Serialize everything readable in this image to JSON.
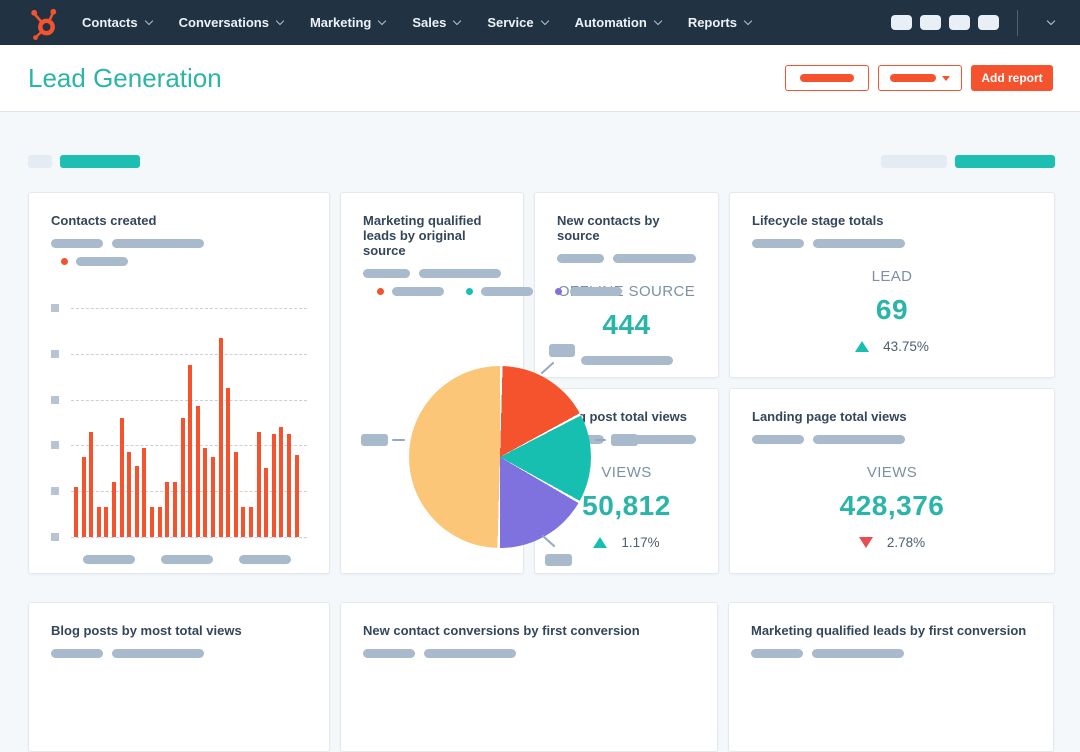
{
  "colors": {
    "navy_bar": "#213343",
    "orange": "#f4532d",
    "teal": "#1dbfb2",
    "teal_text": "#2ab5a8",
    "purple": "#7f72de",
    "yellow": "#fbc678",
    "pie_teal": "#17bfb0",
    "red_down": "#e94c53",
    "title_text": "#33475b",
    "muted_label": "#7d90a5",
    "skeleton_dark": "#a8bacb",
    "skeleton_light": "#e4ebf2",
    "page_bg": "#f5f8fb",
    "card_border": "#e4e9f0",
    "grid_line": "#c6d1dc"
  },
  "nav": {
    "items": [
      {
        "label": "Contacts"
      },
      {
        "label": "Conversations"
      },
      {
        "label": "Marketing"
      },
      {
        "label": "Sales"
      },
      {
        "label": "Service"
      },
      {
        "label": "Automation"
      },
      {
        "label": "Reports"
      }
    ],
    "icon_placeholder_count": 4
  },
  "header": {
    "title": "Lead Generation",
    "add_report_label": "Add report"
  },
  "cards": {
    "contacts_created": {
      "title": "Contacts created"
    },
    "new_contacts_by_source": {
      "title": "New contacts by source",
      "metric_label": "OFFLINE SOURCE",
      "value": "444"
    },
    "lifecycle_stage_totals": {
      "title": "Lifecycle stage totals",
      "metric_label": "LEAD",
      "value": "69",
      "delta": "43.75%",
      "direction": "up"
    },
    "mql_by_original_source": {
      "title": "Marketing qualified leads by original source"
    },
    "blog_post_total_views": {
      "title": "Blog post total views",
      "metric_label": "VIEWS",
      "value": "50,812",
      "delta": "1.17%",
      "direction": "up"
    },
    "landing_page_total_views": {
      "title": "Landing page total views",
      "metric_label": "VIEWS",
      "value": "428,376",
      "delta": "2.78%",
      "direction": "down"
    },
    "blog_posts_by_most_total_views": {
      "title": "Blog posts by most total views"
    },
    "new_contact_conversions_by_first_conversion": {
      "title": "New contact conversions by first conversion"
    },
    "mql_by_first_conversion": {
      "title": "Marketing qualified leads by first conversion"
    }
  },
  "chart_data": [
    {
      "type": "bar",
      "title": "Contacts created",
      "values": [
        22,
        35,
        46,
        13,
        13,
        24,
        52,
        37,
        31,
        39,
        13,
        13,
        24,
        24,
        52,
        75,
        57,
        39,
        35,
        87,
        65,
        37,
        13,
        13,
        46,
        30,
        45,
        48,
        45,
        36
      ],
      "value_unit": "percent_of_plot_height",
      "bar_color": "#f4532d",
      "gridline_count": 6,
      "y_tick_placeholder_count": 6,
      "x_label_placeholder_count": 3,
      "note": "axis tick and category labels are gray skeleton placeholders; no numeric labels rendered"
    },
    {
      "type": "pie",
      "title": "Marketing qualified leads by original source",
      "values": [
        17,
        16,
        17,
        50
      ],
      "slice_colors": [
        "#f4532d",
        "#17bfb0",
        "#7f72de",
        "#fbc678"
      ],
      "labels": [
        "placeholder",
        "placeholder",
        "placeholder",
        "placeholder"
      ],
      "legend_dot_colors": [
        "#f4532d",
        "#17bfb0",
        "#7f72de"
      ],
      "note": "slice callout labels are gray skeleton placeholders"
    }
  ]
}
